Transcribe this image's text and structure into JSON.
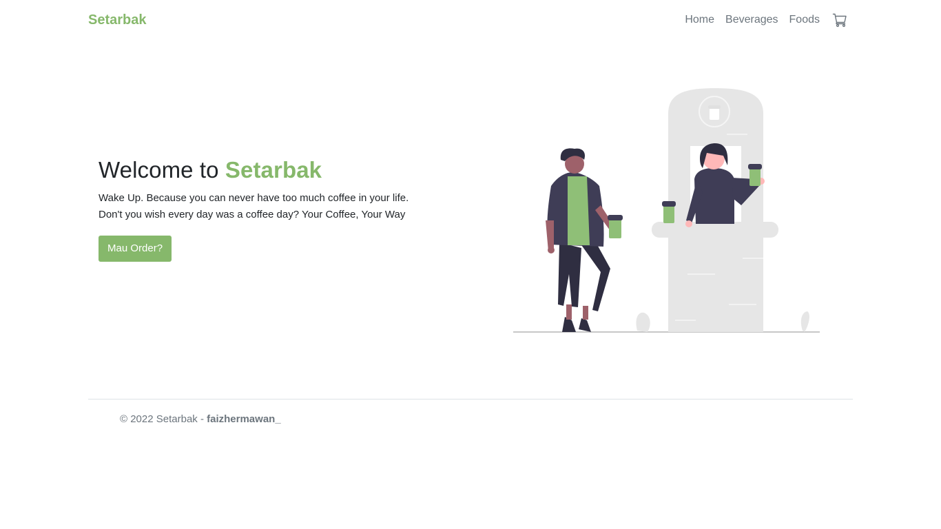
{
  "navbar": {
    "brand": "Setarbak",
    "links": [
      "Home",
      "Beverages",
      "Foods"
    ],
    "cart_icon": "cart-icon"
  },
  "hero": {
    "title_prefix": "Welcome to",
    "title_accent": "Setarbak",
    "subtitle_line1": "Wake Up. Because you can never have too much coffee in your life.",
    "subtitle_line2": "Don't you wish every day was a coffee day? Your Coffee, Your Way",
    "button_label": "Mau Order?"
  },
  "footer": {
    "copyright": "© 2022 Setarbak - ",
    "author": "faizhermawan_"
  },
  "colors": {
    "accent": "#86b86b",
    "muted": "#6c757d",
    "text": "#212529"
  }
}
